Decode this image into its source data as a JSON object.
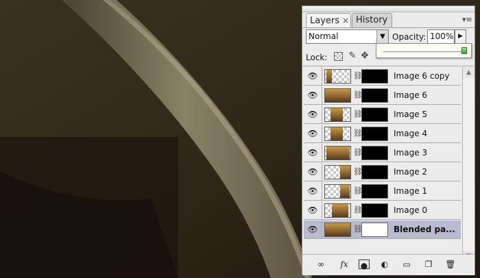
{
  "panel": {
    "tabs": [
      {
        "label": "Layers",
        "close": "×"
      },
      {
        "label": "History"
      }
    ],
    "blend_mode": "Normal",
    "opacity_label": "Opacity:",
    "opacity_value": "100%",
    "opacity_fraction": 1.0,
    "lock_label": "Lock:"
  },
  "layers": [
    {
      "name": "Image 6 copy",
      "visible": true,
      "selected": false,
      "mask": "black"
    },
    {
      "name": "Image 6",
      "visible": true,
      "selected": false,
      "mask": "black"
    },
    {
      "name": "Image 5",
      "visible": true,
      "selected": false,
      "mask": "black"
    },
    {
      "name": "Image 4",
      "visible": true,
      "selected": false,
      "mask": "black"
    },
    {
      "name": "Image 3",
      "visible": true,
      "selected": false,
      "mask": "black"
    },
    {
      "name": "Image 2",
      "visible": true,
      "selected": false,
      "mask": "black"
    },
    {
      "name": "Image 1",
      "visible": true,
      "selected": false,
      "mask": "black"
    },
    {
      "name": "Image 0",
      "visible": true,
      "selected": false,
      "mask": "black"
    },
    {
      "name": "Blended pa...",
      "visible": true,
      "selected": true,
      "mask": "white"
    }
  ],
  "toolbar": {
    "link": "link-layers-icon",
    "fx": "fx",
    "mask": "add-mask-icon",
    "adjustment": "adjustment-layer-icon",
    "group": "folder-icon",
    "new": "new-layer-icon",
    "delete": "trash-icon"
  },
  "colors": {
    "panel_bg": "#ececec",
    "selected_row": "#b9bcd0",
    "photo_dark": "#2a2318"
  }
}
